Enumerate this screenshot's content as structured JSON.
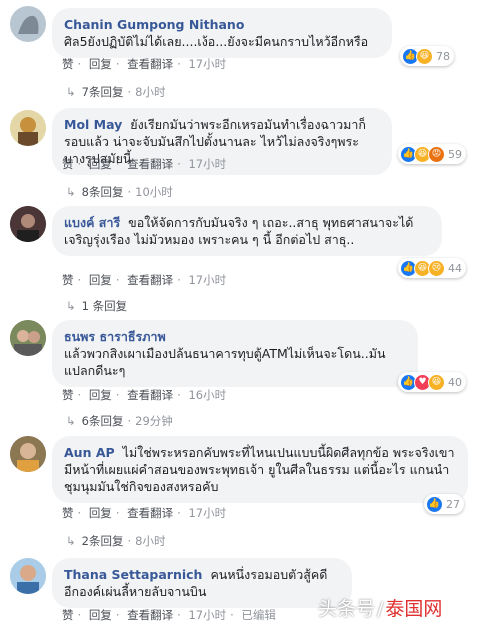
{
  "colors": {
    "link": "#385898",
    "bubble": "#f2f3f5",
    "like": "#1877f2",
    "love": "#f33e58",
    "haha": "#f7b125"
  },
  "comments": [
    {
      "author": "Chanin Gumpong Nithano",
      "text": "ศิล5ยังปฏิบัติไม่ได้เลย....เง้อ...ยังจะมีคนกราบไหว้อีกหรือ",
      "reactions": [
        "like",
        "haha"
      ],
      "count": "78",
      "actions": {
        "like": "赞",
        "reply": "回复",
        "translate": "查看翻译",
        "time": "17小时"
      },
      "replies": "7条回复",
      "replies_time": "8小时"
    },
    {
      "author": "Mol May",
      "text": "ยังเรียกมันว่าพระอีกเหรอมันทำเรื่องฉาวมาก็รอบแล้ว น่าจะจับมันสึกไปตั้งนานละ ไหว้ไม่ลงจริงๆพระบางรูปสมัยนี้",
      "reactions": [
        "like",
        "haha",
        "angry"
      ],
      "count": "59",
      "actions": {
        "like": "赞",
        "reply": "回复",
        "translate": "查看翻译",
        "time": "17小时"
      },
      "replies": "8条回复",
      "replies_time": "10小时"
    },
    {
      "author": "แบงค์ สารี",
      "text": "ขอให้จัดการกับมันจริง ๆ เถอะ..สาธุ พุทธศาสนาจะได้เจริญรุ่งเรือง ไม่มัวหมอง เพราะคน ๆ นี้ อีกต่อไป สาธุ..",
      "reactions": [
        "like",
        "haha",
        "sad"
      ],
      "count": "44",
      "actions": {
        "like": "赞",
        "reply": "回复",
        "translate": "查看翻译",
        "time": "17小时"
      },
      "replies": "1 条回复",
      "replies_time": ""
    },
    {
      "author": "ธนพร ธาราธีรภาพ",
      "text": "แล้วพวกสิงเผาเมืองปล้นธนาคารทุบตู้ATMไม่เห็นจะโดน..มันแปลกดีนะๆ",
      "reactions": [
        "like",
        "love",
        "haha"
      ],
      "count": "40",
      "actions": {
        "like": "赞",
        "reply": "回复",
        "translate": "查看翻译",
        "time": "16小时"
      },
      "replies": "6条回复",
      "replies_time": "29分钟"
    },
    {
      "author": "Aun AP",
      "text": "ไม่ใช่พระหรอกคับพระที่ไหนเปนแบบนี้ผิดศีลทุกข้อ พระจริงเขามีหน้าที่เผยแผ่คำสอนของพระพุทธเจ้า ยูในศีลในธรรม แต่นี้อะไร แกนนำชุมนุมมันใช่กิจของสงหรอคับ",
      "reactions": [
        "like"
      ],
      "count": "27",
      "actions": {
        "like": "赞",
        "reply": "回复",
        "translate": "查看翻译",
        "time": "17小时"
      },
      "replies": "2条回复",
      "replies_time": "8小时"
    },
    {
      "author": "Thana Settaparnich",
      "text": "คนหนึ่งรอมอบตัวสู้คดี อีกองค์เผ่นลี้หายลับจานบิน",
      "reactions": [],
      "count": "",
      "actions": {
        "like": "赞",
        "reply": "回复",
        "translate": "查看翻译",
        "time": "17小时",
        "edited": "已编辑"
      },
      "replies": "",
      "replies_time": ""
    }
  ],
  "watermark": {
    "part1": "头条号",
    "part2": "泰国网"
  }
}
